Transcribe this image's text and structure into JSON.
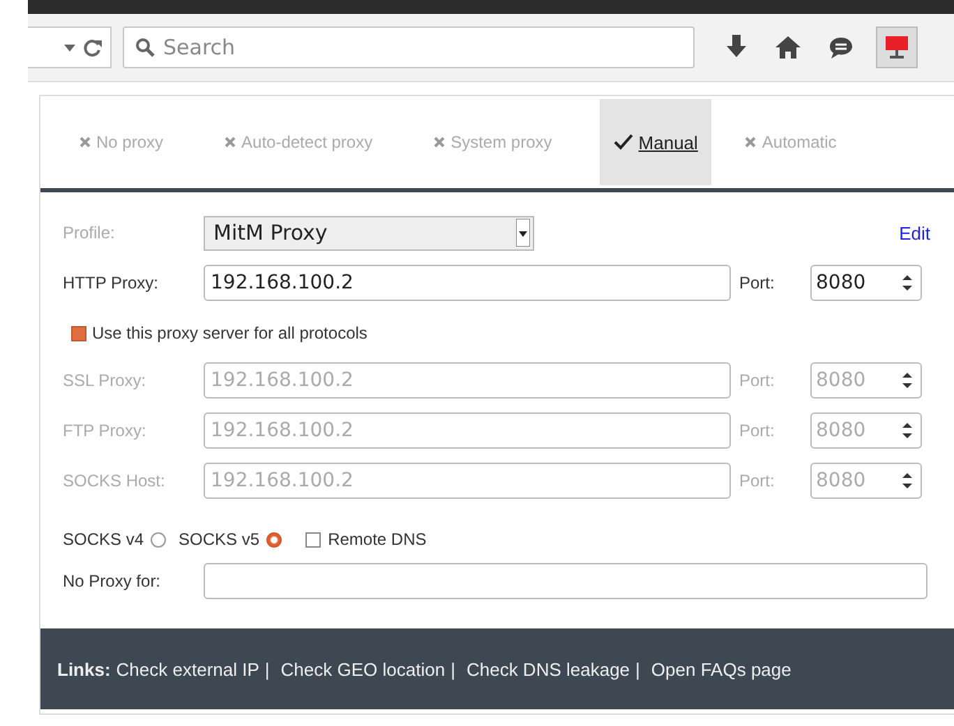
{
  "toolbar": {
    "search": {
      "placeholder": "Search"
    }
  },
  "tabs": [
    {
      "label": "No proxy",
      "selected": false
    },
    {
      "label": "Auto-detect proxy",
      "selected": false
    },
    {
      "label": "System proxy",
      "selected": false
    },
    {
      "label": "Manual",
      "selected": true
    },
    {
      "label": "Automatic",
      "selected": false
    }
  ],
  "form": {
    "profile": {
      "label": "Profile:",
      "value": "MitM Proxy"
    },
    "edit_link": "Edit",
    "proxies": [
      {
        "label": "HTTP Proxy:",
        "host": "192.168.100.2",
        "port_label": "Port:",
        "port": "8080",
        "disabled": false
      },
      {
        "label": "SSL Proxy:",
        "host": "192.168.100.2",
        "port_label": "Port:",
        "port": "8080",
        "disabled": true
      },
      {
        "label": "FTP Proxy:",
        "host": "192.168.100.2",
        "port_label": "Port:",
        "port": "8080",
        "disabled": true
      },
      {
        "label": "SOCKS Host:",
        "host": "192.168.100.2",
        "port_label": "Port:",
        "port": "8080",
        "disabled": true
      }
    ],
    "use_for_all": {
      "label": "Use this proxy server for all protocols",
      "checked": true
    },
    "socks": [
      {
        "label": "SOCKS v4",
        "selected": false
      },
      {
        "label": "SOCKS v5",
        "selected": true
      }
    ],
    "remote_dns": {
      "label": "Remote DNS",
      "checked": false
    },
    "no_proxy": {
      "label": "No Proxy for:"
    }
  },
  "footer": {
    "label": "Links:",
    "links": [
      {
        "label": "Check external IP",
        "separator": "|"
      },
      {
        "label": "Check GEO location",
        "separator": "|"
      },
      {
        "label": "Check DNS leakage",
        "separator": "|"
      },
      {
        "label": "Open FAQs page"
      }
    ]
  }
}
